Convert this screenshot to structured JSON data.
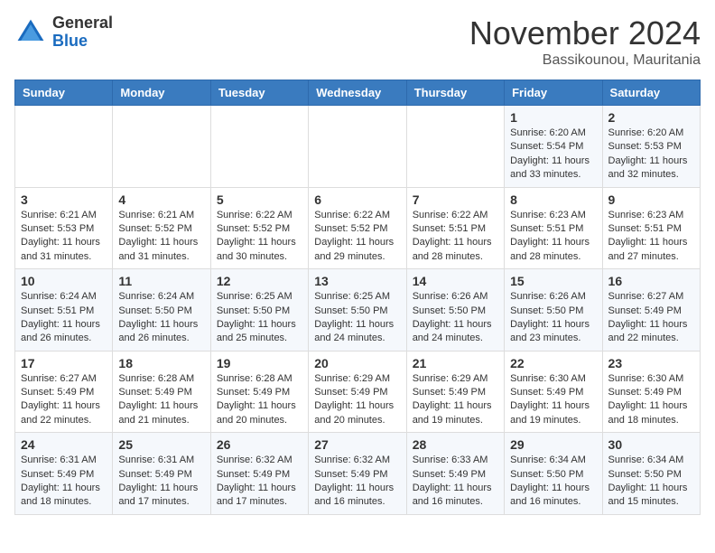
{
  "header": {
    "logo_general": "General",
    "logo_blue": "Blue",
    "month_title": "November 2024",
    "location": "Bassikounou, Mauritania"
  },
  "weekdays": [
    "Sunday",
    "Monday",
    "Tuesday",
    "Wednesday",
    "Thursday",
    "Friday",
    "Saturday"
  ],
  "weeks": [
    [
      {
        "day": "",
        "info": ""
      },
      {
        "day": "",
        "info": ""
      },
      {
        "day": "",
        "info": ""
      },
      {
        "day": "",
        "info": ""
      },
      {
        "day": "",
        "info": ""
      },
      {
        "day": "1",
        "info": "Sunrise: 6:20 AM\nSunset: 5:54 PM\nDaylight: 11 hours and 33 minutes."
      },
      {
        "day": "2",
        "info": "Sunrise: 6:20 AM\nSunset: 5:53 PM\nDaylight: 11 hours and 32 minutes."
      }
    ],
    [
      {
        "day": "3",
        "info": "Sunrise: 6:21 AM\nSunset: 5:53 PM\nDaylight: 11 hours and 31 minutes."
      },
      {
        "day": "4",
        "info": "Sunrise: 6:21 AM\nSunset: 5:52 PM\nDaylight: 11 hours and 31 minutes."
      },
      {
        "day": "5",
        "info": "Sunrise: 6:22 AM\nSunset: 5:52 PM\nDaylight: 11 hours and 30 minutes."
      },
      {
        "day": "6",
        "info": "Sunrise: 6:22 AM\nSunset: 5:52 PM\nDaylight: 11 hours and 29 minutes."
      },
      {
        "day": "7",
        "info": "Sunrise: 6:22 AM\nSunset: 5:51 PM\nDaylight: 11 hours and 28 minutes."
      },
      {
        "day": "8",
        "info": "Sunrise: 6:23 AM\nSunset: 5:51 PM\nDaylight: 11 hours and 28 minutes."
      },
      {
        "day": "9",
        "info": "Sunrise: 6:23 AM\nSunset: 5:51 PM\nDaylight: 11 hours and 27 minutes."
      }
    ],
    [
      {
        "day": "10",
        "info": "Sunrise: 6:24 AM\nSunset: 5:51 PM\nDaylight: 11 hours and 26 minutes."
      },
      {
        "day": "11",
        "info": "Sunrise: 6:24 AM\nSunset: 5:50 PM\nDaylight: 11 hours and 26 minutes."
      },
      {
        "day": "12",
        "info": "Sunrise: 6:25 AM\nSunset: 5:50 PM\nDaylight: 11 hours and 25 minutes."
      },
      {
        "day": "13",
        "info": "Sunrise: 6:25 AM\nSunset: 5:50 PM\nDaylight: 11 hours and 24 minutes."
      },
      {
        "day": "14",
        "info": "Sunrise: 6:26 AM\nSunset: 5:50 PM\nDaylight: 11 hours and 24 minutes."
      },
      {
        "day": "15",
        "info": "Sunrise: 6:26 AM\nSunset: 5:50 PM\nDaylight: 11 hours and 23 minutes."
      },
      {
        "day": "16",
        "info": "Sunrise: 6:27 AM\nSunset: 5:49 PM\nDaylight: 11 hours and 22 minutes."
      }
    ],
    [
      {
        "day": "17",
        "info": "Sunrise: 6:27 AM\nSunset: 5:49 PM\nDaylight: 11 hours and 22 minutes."
      },
      {
        "day": "18",
        "info": "Sunrise: 6:28 AM\nSunset: 5:49 PM\nDaylight: 11 hours and 21 minutes."
      },
      {
        "day": "19",
        "info": "Sunrise: 6:28 AM\nSunset: 5:49 PM\nDaylight: 11 hours and 20 minutes."
      },
      {
        "day": "20",
        "info": "Sunrise: 6:29 AM\nSunset: 5:49 PM\nDaylight: 11 hours and 20 minutes."
      },
      {
        "day": "21",
        "info": "Sunrise: 6:29 AM\nSunset: 5:49 PM\nDaylight: 11 hours and 19 minutes."
      },
      {
        "day": "22",
        "info": "Sunrise: 6:30 AM\nSunset: 5:49 PM\nDaylight: 11 hours and 19 minutes."
      },
      {
        "day": "23",
        "info": "Sunrise: 6:30 AM\nSunset: 5:49 PM\nDaylight: 11 hours and 18 minutes."
      }
    ],
    [
      {
        "day": "24",
        "info": "Sunrise: 6:31 AM\nSunset: 5:49 PM\nDaylight: 11 hours and 18 minutes."
      },
      {
        "day": "25",
        "info": "Sunrise: 6:31 AM\nSunset: 5:49 PM\nDaylight: 11 hours and 17 minutes."
      },
      {
        "day": "26",
        "info": "Sunrise: 6:32 AM\nSunset: 5:49 PM\nDaylight: 11 hours and 17 minutes."
      },
      {
        "day": "27",
        "info": "Sunrise: 6:32 AM\nSunset: 5:49 PM\nDaylight: 11 hours and 16 minutes."
      },
      {
        "day": "28",
        "info": "Sunrise: 6:33 AM\nSunset: 5:49 PM\nDaylight: 11 hours and 16 minutes."
      },
      {
        "day": "29",
        "info": "Sunrise: 6:34 AM\nSunset: 5:50 PM\nDaylight: 11 hours and 16 minutes."
      },
      {
        "day": "30",
        "info": "Sunrise: 6:34 AM\nSunset: 5:50 PM\nDaylight: 11 hours and 15 minutes."
      }
    ]
  ]
}
